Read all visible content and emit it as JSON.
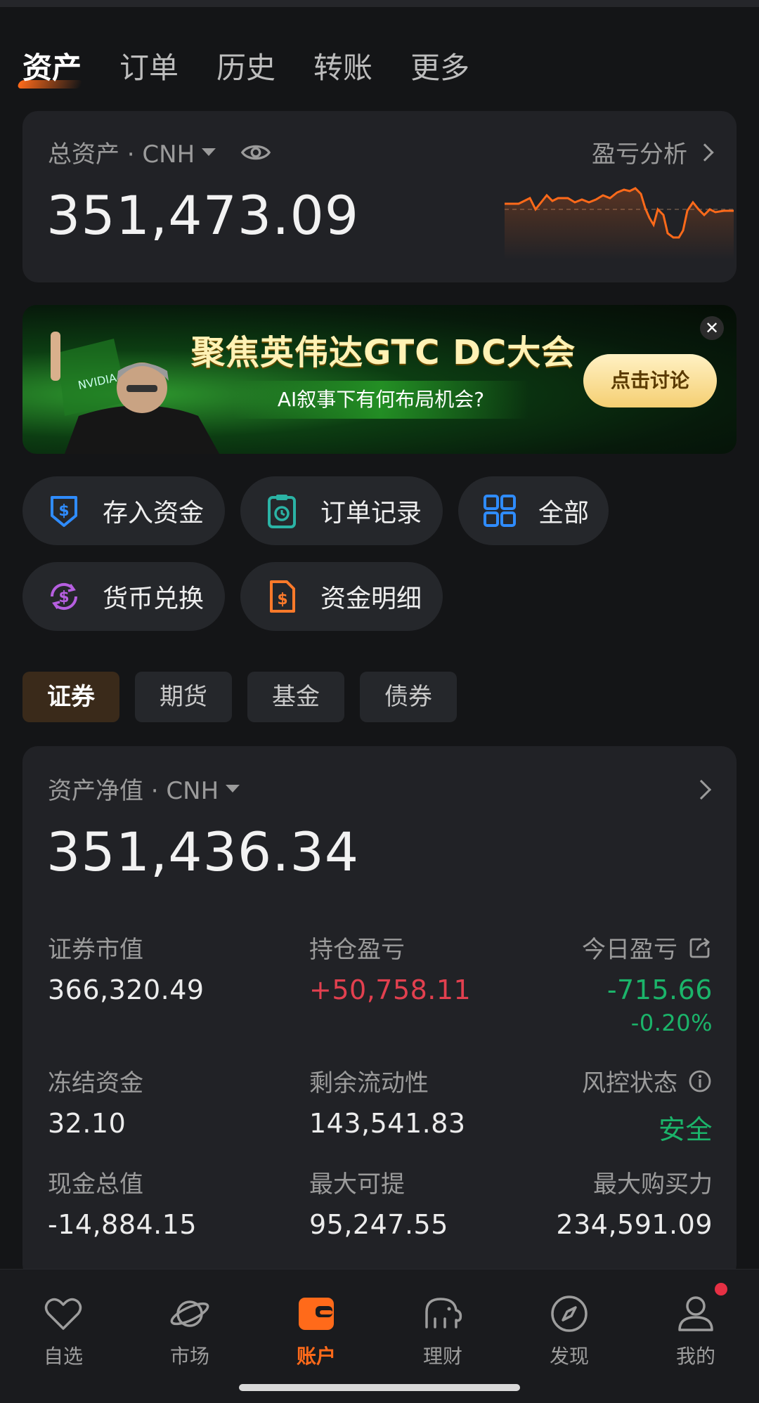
{
  "top_tabs": [
    "资产",
    "订单",
    "历史",
    "转账",
    "更多"
  ],
  "total": {
    "label": "总资产 · CNH",
    "value": "351,473.09",
    "pnl_link": "盈亏分析"
  },
  "banner": {
    "title": "聚焦英伟达GTC DC大会",
    "subtitle": "AI叙事下有何布局机会?",
    "button": "点击讨论",
    "close": "✕"
  },
  "quick_actions": [
    "存入资金",
    "订单记录",
    "全部",
    "货币兑换",
    "资金明细"
  ],
  "segments": [
    "证券",
    "期货",
    "基金",
    "债券"
  ],
  "net": {
    "label": "资产净值 · CNH",
    "value": "351,436.34",
    "metrics": [
      {
        "label": "证券市值",
        "value": "366,320.49"
      },
      {
        "label": "持仓盈亏",
        "value": "+50,758.11"
      },
      {
        "label": "今日盈亏",
        "value": "-715.66",
        "sub": "-0.20%"
      },
      {
        "label": "冻结资金",
        "value": "32.10"
      },
      {
        "label": "剩余流动性",
        "value": "143,541.83"
      },
      {
        "label": "风控状态",
        "value": "安全"
      },
      {
        "label": "现金总值",
        "value": "-14,884.15"
      },
      {
        "label": "最大可提",
        "value": "95,247.55"
      },
      {
        "label": "最大购买力",
        "value": "234,591.09"
      }
    ]
  },
  "bottom_nav": [
    "自选",
    "市场",
    "账户",
    "理财",
    "发现",
    "我的"
  ],
  "colors": {
    "accent": "#ff6a1a",
    "positive": "#e2404f",
    "negative": "#1bb46a",
    "background": "#141517",
    "card": "#212226"
  },
  "icons": [
    "eye-icon",
    "chevron-right-icon",
    "deposit-icon",
    "order-record-icon",
    "grid-icon",
    "currency-exchange-icon",
    "fund-detail-icon",
    "share-icon",
    "info-icon",
    "heart-icon",
    "planet-icon",
    "wallet-icon",
    "elephant-icon",
    "compass-icon",
    "user-icon"
  ]
}
